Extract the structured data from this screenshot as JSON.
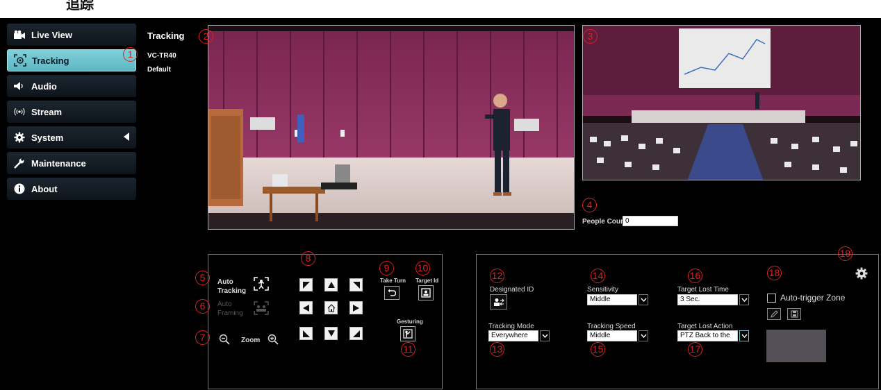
{
  "header": {
    "logo_text": "追踪"
  },
  "sidebar": {
    "items": [
      {
        "label": "Live View",
        "icon": "camera-icon",
        "active": false
      },
      {
        "label": "Tracking",
        "icon": "tracking-target-icon",
        "active": true
      },
      {
        "label": "Audio",
        "icon": "speaker-icon",
        "active": false
      },
      {
        "label": "Stream",
        "icon": "broadcast-icon",
        "active": false
      },
      {
        "label": "System",
        "icon": "gear-icon",
        "active": false,
        "has_arrow": true
      },
      {
        "label": "Maintenance",
        "icon": "wrench-icon",
        "active": false
      },
      {
        "label": "About",
        "icon": "info-icon",
        "active": false
      }
    ]
  },
  "breadcrumb": {
    "title": "Tracking",
    "model": "VC-TR40",
    "profile": "Default"
  },
  "people": {
    "label": "People Count",
    "value": "0"
  },
  "ptz_panel": {
    "auto_tracking_label": "Auto Tracking",
    "auto_framing_label": "Auto Framing",
    "zoom_label": "Zoom",
    "take_turn_label": "Take Turn",
    "target_id_label": "Target Id",
    "gesturing_label": "Gesturing"
  },
  "settings_panel": {
    "designated_id_label": "Designated ID",
    "tracking_mode_label": "Tracking Mode",
    "tracking_mode_value": "Everywhere",
    "sensitivity_label": "Sensitivity",
    "sensitivity_value": "Middle",
    "tracking_speed_label": "Tracking Speed",
    "tracking_speed_value": "Middle",
    "target_lost_time_label": "Target Lost Time",
    "target_lost_time_value": "3 Sec.",
    "target_lost_action_label": "Target Lost Action",
    "target_lost_action_value": "PTZ Back to the",
    "auto_trigger_label": "Auto-trigger Zone"
  },
  "callouts": [
    "1",
    "2",
    "3",
    "4",
    "5",
    "6",
    "7",
    "8",
    "9",
    "10",
    "11",
    "12",
    "13",
    "14",
    "15",
    "16",
    "17",
    "18",
    "19"
  ],
  "colors": {
    "accent": "#6cc4ce",
    "callout": "#e02020",
    "stage_wall": "#8a2f5a"
  }
}
